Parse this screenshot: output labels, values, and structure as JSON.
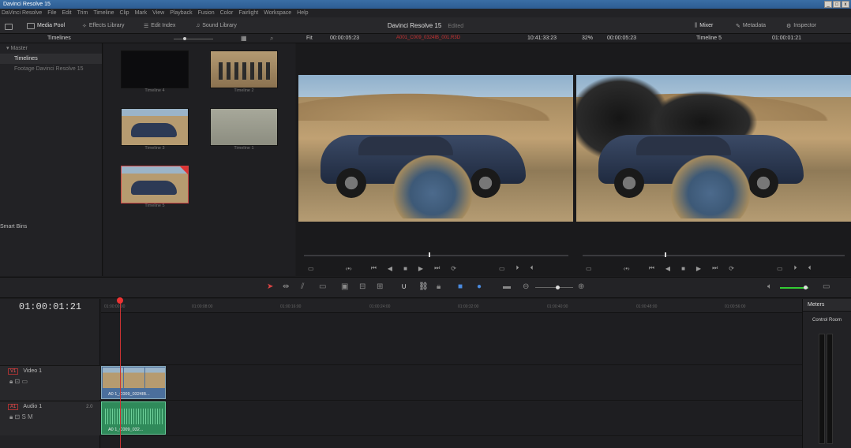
{
  "window": {
    "title": "Davinci Resolve 15",
    "controls": [
      "_",
      "□",
      "x"
    ]
  },
  "menu": [
    "DaVinci Resolve",
    "File",
    "Edit",
    "Trim",
    "Timeline",
    "Clip",
    "Mark",
    "View",
    "Playback",
    "Fusion",
    "Color",
    "Fairlight",
    "Workspace",
    "Help"
  ],
  "toolbar": {
    "media_pool": "Media Pool",
    "effects_library": "Effects Library",
    "edit_index": "Edit Index",
    "sound_library": "Sound Library",
    "project_title": "Davinci Resolve 15",
    "project_status": "Edited",
    "mixer": "Mixer",
    "metadata": "Metadata",
    "inspector": "Inspector"
  },
  "subbar": {
    "bin_label": "Timelines",
    "fit": "Fit",
    "source_tc": "00:00:05:23",
    "clip_name": "A001_C009_0324IB_001.R3D",
    "source_tc2": "10:41:33:23",
    "zoom": "32%",
    "rec_tc": "00:00:05:23",
    "timeline_name": "Timeline 5",
    "rec_tc2": "01:00:01:21"
  },
  "bins": {
    "master": "Master",
    "items": [
      "Timelines",
      "Footage Davinci Resolve 15"
    ],
    "smart_bins": "Smart Bins"
  },
  "pool_items": [
    "Timeline 4",
    "Timeline 2",
    "Timeline 3",
    "Timeline 1",
    "Timeline 5"
  ],
  "timeline": {
    "timecode": "01:00:01:21",
    "ruler": [
      "01:00:00:00",
      "01:00:08:00",
      "01:00:16:00",
      "01:00:24:00",
      "01:00:32:00",
      "01:00:40:00",
      "01:00:48:00",
      "01:00:56:00"
    ],
    "tracks": [
      {
        "badge": "V1",
        "name": "Video 1",
        "clip": "A0 1_C009_0324IB..."
      },
      {
        "badge": "A1",
        "name": "Audio 1",
        "level": "2.0",
        "clip": "A0 1_C009_032..."
      }
    ]
  },
  "meters": {
    "title": "Meters",
    "room": "Control Room"
  }
}
